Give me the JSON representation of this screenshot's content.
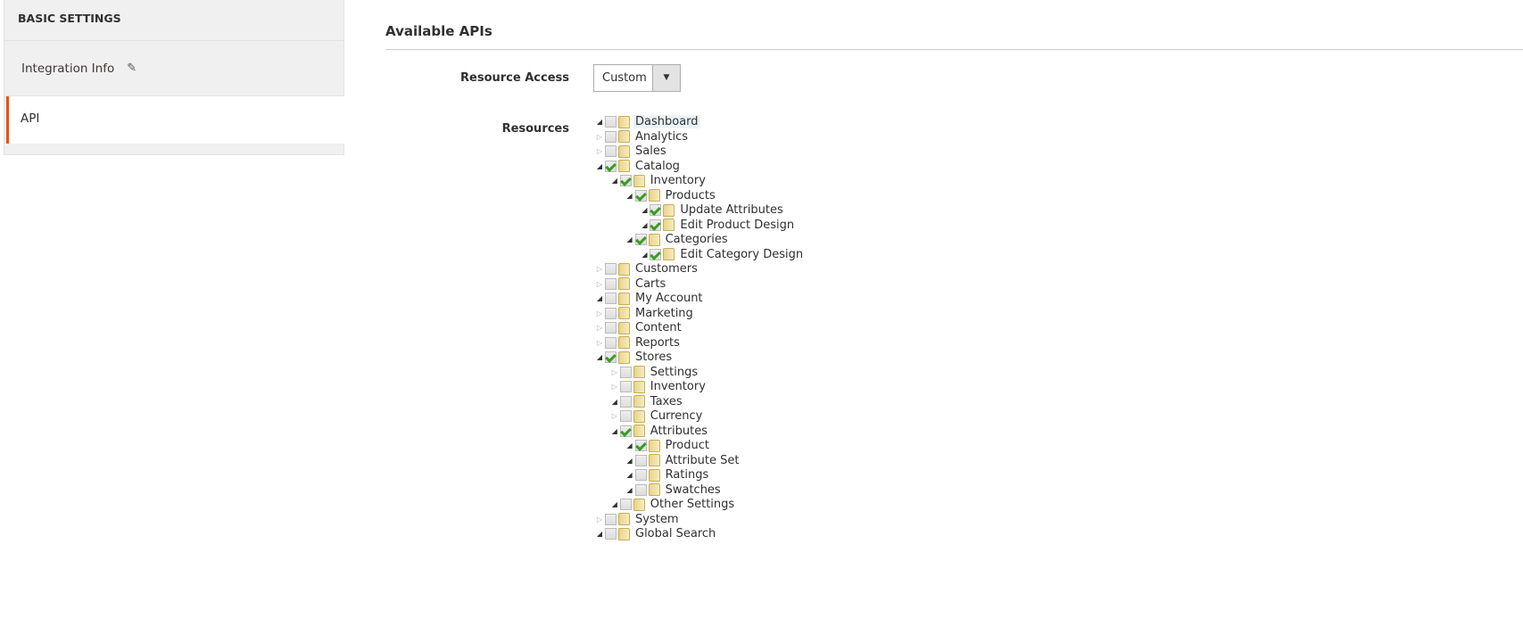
{
  "sidebar": {
    "title": "BASIC SETTINGS",
    "items": [
      {
        "label": "Integration Info",
        "icon": "pencil-icon"
      },
      {
        "label": "API",
        "active": true
      }
    ]
  },
  "main": {
    "title": "Available APIs",
    "resource_access_label": "Resource Access",
    "resource_access_value": "Custom",
    "resources_label": "Resources"
  },
  "colors": {
    "accent": "#eb5202",
    "check": "#3a9d23"
  },
  "tree": [
    {
      "label": "Dashboard",
      "level": 0,
      "expanded": true,
      "checked": false,
      "hover": true
    },
    {
      "label": "Analytics",
      "level": 0,
      "expanded": false,
      "checked": false
    },
    {
      "label": "Sales",
      "level": 0,
      "expanded": false,
      "checked": false
    },
    {
      "label": "Catalog",
      "level": 0,
      "expanded": true,
      "checked": true
    },
    {
      "label": "Inventory",
      "level": 1,
      "expanded": true,
      "checked": true
    },
    {
      "label": "Products",
      "level": 2,
      "expanded": true,
      "checked": true
    },
    {
      "label": "Update Attributes",
      "level": 3,
      "expanded": true,
      "checked": true
    },
    {
      "label": "Edit Product Design",
      "level": 3,
      "expanded": true,
      "checked": true
    },
    {
      "label": "Categories",
      "level": 2,
      "expanded": true,
      "checked": true
    },
    {
      "label": "Edit Category Design",
      "level": 3,
      "expanded": true,
      "checked": true
    },
    {
      "label": "Customers",
      "level": 0,
      "expanded": false,
      "checked": false
    },
    {
      "label": "Carts",
      "level": 0,
      "expanded": false,
      "checked": false
    },
    {
      "label": "My Account",
      "level": 0,
      "expanded": true,
      "checked": false
    },
    {
      "label": "Marketing",
      "level": 0,
      "expanded": false,
      "checked": false
    },
    {
      "label": "Content",
      "level": 0,
      "expanded": false,
      "checked": false
    },
    {
      "label": "Reports",
      "level": 0,
      "expanded": false,
      "checked": false
    },
    {
      "label": "Stores",
      "level": 0,
      "expanded": true,
      "checked": true
    },
    {
      "label": "Settings",
      "level": 1,
      "expanded": false,
      "checked": false
    },
    {
      "label": "Inventory",
      "level": 1,
      "expanded": false,
      "checked": false
    },
    {
      "label": "Taxes",
      "level": 1,
      "expanded": true,
      "checked": false
    },
    {
      "label": "Currency",
      "level": 1,
      "expanded": false,
      "checked": false
    },
    {
      "label": "Attributes",
      "level": 1,
      "expanded": true,
      "checked": true
    },
    {
      "label": "Product",
      "level": 2,
      "expanded": true,
      "checked": true
    },
    {
      "label": "Attribute Set",
      "level": 2,
      "expanded": true,
      "checked": false
    },
    {
      "label": "Ratings",
      "level": 2,
      "expanded": true,
      "checked": false
    },
    {
      "label": "Swatches",
      "level": 2,
      "expanded": true,
      "checked": false
    },
    {
      "label": "Other Settings",
      "level": 1,
      "expanded": true,
      "checked": false
    },
    {
      "label": "System",
      "level": 0,
      "expanded": false,
      "checked": false
    },
    {
      "label": "Global Search",
      "level": 0,
      "expanded": true,
      "checked": false
    }
  ]
}
